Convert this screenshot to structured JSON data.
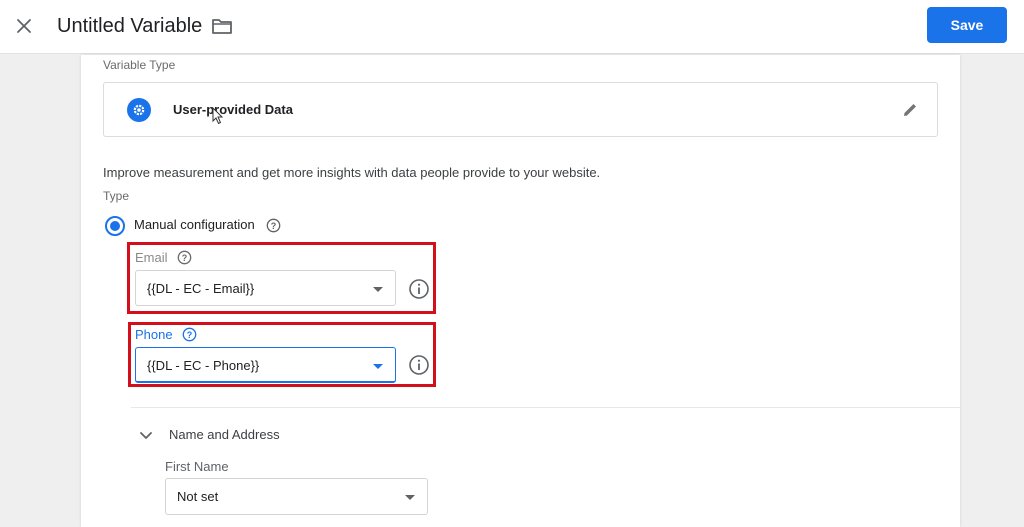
{
  "header": {
    "title": "Untitled Variable",
    "save_label": "Save"
  },
  "variable_type": {
    "label": "Variable Type",
    "name": "User-provided Data",
    "icon": "gear-icon",
    "accent_color": "#1a73e8"
  },
  "description": "Improve measurement and get more insights with data people provide to your website.",
  "type": {
    "label": "Type",
    "selected_option": "Manual configuration"
  },
  "fields": {
    "email": {
      "label": "Email",
      "value": "{{DL - EC - Email}}"
    },
    "phone": {
      "label": "Phone",
      "value": "{{DL - EC - Phone}}"
    }
  },
  "name_address": {
    "title": "Name and Address",
    "first_name": {
      "label": "First Name",
      "value": "Not set"
    }
  },
  "colors": {
    "primary": "#1a73e8",
    "highlight": "#d20f1a"
  }
}
